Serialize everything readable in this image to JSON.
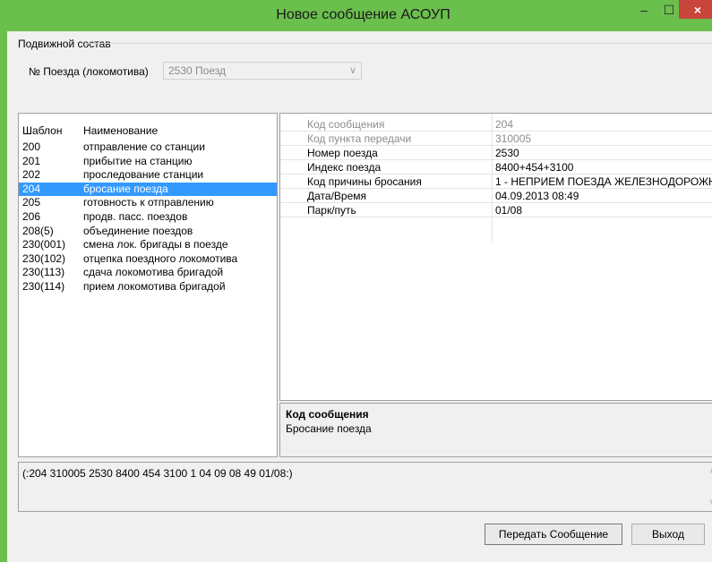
{
  "window": {
    "title": "Новое сообщение АСОУП",
    "min_icon": "–",
    "max_icon": "☐",
    "close_icon": "×"
  },
  "group": {
    "label": "Подвижной состав"
  },
  "train": {
    "label": "№ Поезда (локомотива)",
    "value": "2530  Поезд",
    "arrow": "∨"
  },
  "templates": {
    "headers": {
      "code": "Шаблон",
      "name": "Наименование"
    },
    "items": [
      {
        "code": "200",
        "name": "отправление со станции"
      },
      {
        "code": "201",
        "name": "прибытие на станцию"
      },
      {
        "code": "202",
        "name": "проследование станции"
      },
      {
        "code": "204",
        "name": "бросание поезда"
      },
      {
        "code": "205",
        "name": "готовность к отправлению"
      },
      {
        "code": "206",
        "name": "продв. пасс. поездов"
      },
      {
        "code": "208(5)",
        "name": "объединение поездов"
      },
      {
        "code": "230(001)",
        "name": "смена лок. бригады в поезде"
      },
      {
        "code": "230(102)",
        "name": "отцепка поездного локомотива"
      },
      {
        "code": "230(113)",
        "name": "сдача локомотива бригадой"
      },
      {
        "code": "230(114)",
        "name": "прием локомотива бригадой"
      }
    ],
    "selected": "204"
  },
  "properties": [
    {
      "key": "Код сообщения",
      "value": "204",
      "readonly": true
    },
    {
      "key": "Код пункта передачи",
      "value": "310005",
      "readonly": true
    },
    {
      "key": "Номер поезда",
      "value": "2530",
      "readonly": false
    },
    {
      "key": "Индекс поезда",
      "value": "8400+454+3100",
      "readonly": false
    },
    {
      "key": "Код причины бросания",
      "value": "1 - НЕПРИЕМ ПОЕЗДА ЖЕЛЕЗНОДОРОЖН",
      "readonly": false
    },
    {
      "key": "Дата/Время",
      "value": "04.09.2013 08:49",
      "readonly": false
    },
    {
      "key": "Парк/путь",
      "value": "01/08",
      "readonly": false
    }
  ],
  "description": {
    "title": "Код сообщения",
    "text": "Бросание поезда"
  },
  "message": {
    "text": "(:204 310005 2530 8400 454 3100 1 04 09 08 49 01/08:)",
    "up_icon": "∧",
    "down_icon": "∨"
  },
  "buttons": {
    "send": "Передать Сообщение",
    "exit": "Выход"
  },
  "colors": {
    "frame": "#6bbf4d",
    "selection": "#3399ff",
    "close": "#c7453b"
  }
}
